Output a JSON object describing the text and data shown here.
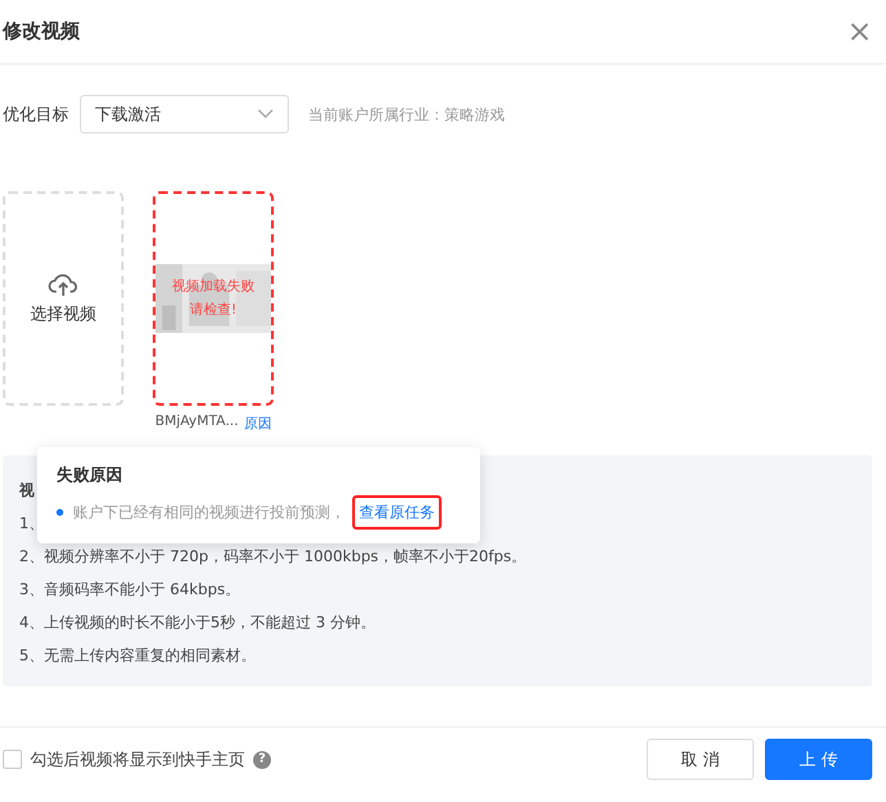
{
  "dialog": {
    "title": "修改视频",
    "close": "×"
  },
  "goal": {
    "label": "优化目标",
    "value": "下载激活",
    "industry": "当前账户所属行业：策略游戏"
  },
  "upload": {
    "label": "选择视频"
  },
  "video": {
    "error": [
      "视频加载失败",
      "请检查!"
    ],
    "filename": "BMjAyMTA...",
    "reason_link": "原因",
    "failed": true
  },
  "requirements": {
    "title": "视",
    "items": [
      "1、",
      "2、视频分辨率不小于 720p，码率不小于 1000kbps，帧率不小于20fps。",
      "3、音频码率不能小于 64kbps。",
      "4、上传视频的时长不能小于5秒，不能超过 3 分钟。",
      "5、无需上传内容重复的相同素材。"
    ]
  },
  "popover": {
    "title": "失败原因",
    "reason": "账户下已经有相同的视频进行投前预测，",
    "link": "查看原任务"
  },
  "footer": {
    "checkbox": {
      "label": "勾选后视频将显示到快手主页",
      "checked": false
    },
    "help": "?",
    "buttons": [
      {
        "label": "取 消",
        "kind": "secondary"
      },
      {
        "label": "上 传",
        "kind": "primary"
      }
    ]
  }
}
